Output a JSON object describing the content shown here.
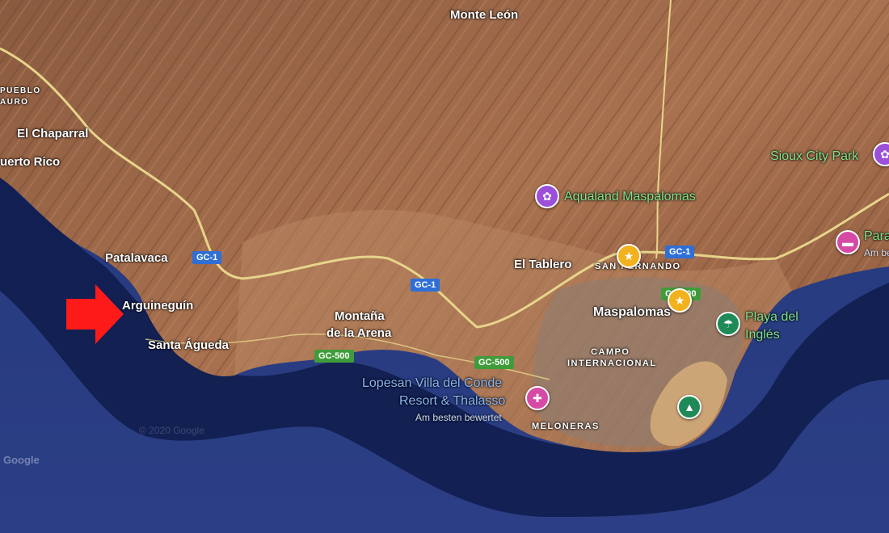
{
  "map": {
    "places": {
      "monte_leon": "Monte León",
      "pueblo": "PUEBLO",
      "mauro": "AURO",
      "el_chaparral": "El Chaparral",
      "puerto_rico": "uerto Rico",
      "patalavaca": "Patalavaca",
      "arguineguin": "Arguineguín",
      "santa_agueda": "Santa Águeda",
      "montana_arena_1": "Montaña",
      "montana_arena_2": "de la Arena",
      "el_tablero": "El Tablero",
      "san_fernando": "SAN FERNANDO",
      "maspalomas": "Maspalomas",
      "campo_1": "CAMPO",
      "campo_2": "INTERNACIONAL",
      "meloneras": "MELONERAS"
    },
    "pois": {
      "aqualand": "Aqualand Maspalomas",
      "sioux": "Sioux City Park",
      "playa_1": "Playa del",
      "playa_2": "Inglés",
      "lopesan_1": "Lopesan Villa del Conde",
      "lopesan_2": "Resort & Thalasso",
      "lopesan_sub": "Am besten bewertet",
      "para": "Para",
      "para_sub": "Am be"
    },
    "roads": {
      "gc1_a": "GC-1",
      "gc1_b": "GC-1",
      "gc1_c": "GC-1",
      "gc500_a": "GC-500",
      "gc500_b": "GC-500",
      "gc500_c": "GC-500"
    },
    "watermark": "Google",
    "copyright": "© 2020 Google"
  },
  "colors": {
    "ocean_deep": "#1b2f6b",
    "ocean_shallow": "#0b1a4a",
    "land": "#a86d4c",
    "arrow": "#ff1a1a",
    "pin_purple": "#9c4fd9",
    "pin_pink": "#d64aa6",
    "pin_green": "#1f8a57",
    "pin_yellow": "#f1b21d"
  }
}
